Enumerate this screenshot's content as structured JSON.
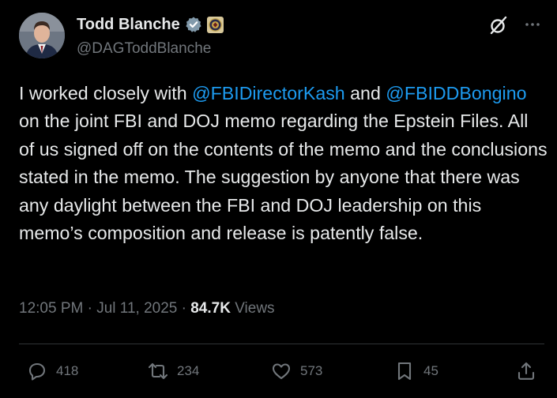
{
  "author": {
    "name": "Todd Blanche",
    "handle": "@DAGToddBlanche",
    "verified_icon": "verified-badge-icon",
    "affiliation_icon": "doj-seal-icon"
  },
  "tweet": {
    "segments": [
      {
        "text": "I worked closely with ",
        "type": "text"
      },
      {
        "text": "@FBIDirectorKash",
        "type": "mention"
      },
      {
        "text": " and ",
        "type": "text"
      },
      {
        "text": "@FBIDDBongino",
        "type": "mention"
      },
      {
        "text": " on the joint FBI and DOJ memo regarding the Epstein Files. All of us signed off on the contents of the memo and the conclusions stated in the memo. The suggestion by anyone that there was any daylight between the FBI and DOJ leadership on this memo’s composition and release is patently false.",
        "type": "text"
      }
    ]
  },
  "meta": {
    "time": "12:05 PM",
    "separator": "·",
    "date": "Jul 11, 2025",
    "views_count": "84.7K",
    "views_label": "Views"
  },
  "actions": {
    "replies": "418",
    "reposts": "234",
    "likes": "573",
    "bookmarks": "45"
  },
  "colors": {
    "background": "#000000",
    "text": "#e7e9ea",
    "secondary": "#71767b",
    "link": "#1d9bf0",
    "divider": "#2f3336"
  }
}
